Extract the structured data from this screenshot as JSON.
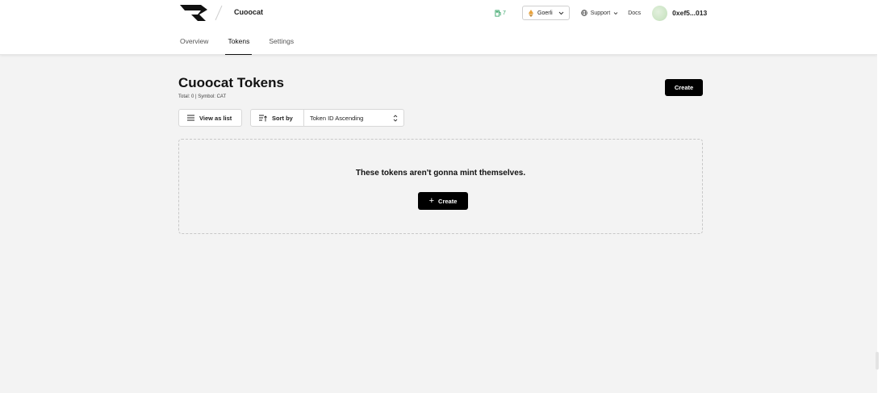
{
  "header": {
    "project_name": "Cuoocat",
    "gas_value": "7",
    "network": "Goerli",
    "support_label": "Support",
    "docs_label": "Docs",
    "address": "0xef5...013"
  },
  "tabs": [
    {
      "label": "Overview",
      "active": false
    },
    {
      "label": "Tokens",
      "active": true
    },
    {
      "label": "Settings",
      "active": false
    }
  ],
  "page": {
    "title": "Cuoocat Tokens",
    "meta": "Total: 0 | Symbol: CAT",
    "create_label": "Create"
  },
  "toolbar": {
    "view_as_list": "View as list",
    "sort_by": "Sort by",
    "sort_value": "Token ID Ascending"
  },
  "empty_state": {
    "message": "These tokens aren't gonna mint themselves.",
    "create_label": "Create"
  },
  "colors": {
    "accent": "#000000",
    "gas_green": "#3aa56a",
    "eth_orange": "#e8a23a"
  },
  "icons": [
    "logo-icon",
    "gas-pump-icon",
    "ethereum-icon",
    "chevron-down-icon",
    "globe-icon",
    "avatar",
    "list-icon",
    "sort-icon",
    "updown-chevron-icon",
    "plus-icon"
  ]
}
